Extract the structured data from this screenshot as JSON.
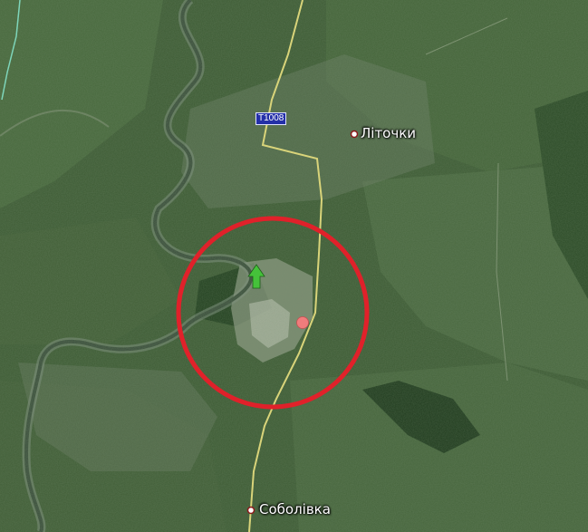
{
  "map": {
    "road_label": "T1008",
    "places": [
      {
        "name": "Літочки"
      },
      {
        "name": "Соболівка"
      }
    ],
    "colors": {
      "terrain": "#3c5a33",
      "river": "#3b4f3c",
      "road": "#d9d47a",
      "highlight_circle": "#e0212a",
      "marker_green": "#45c23a",
      "marker_red": "#f07c7c"
    },
    "icons": [
      "place-dot-icon",
      "green-arrow-marker-icon",
      "red-marker-icon"
    ]
  }
}
